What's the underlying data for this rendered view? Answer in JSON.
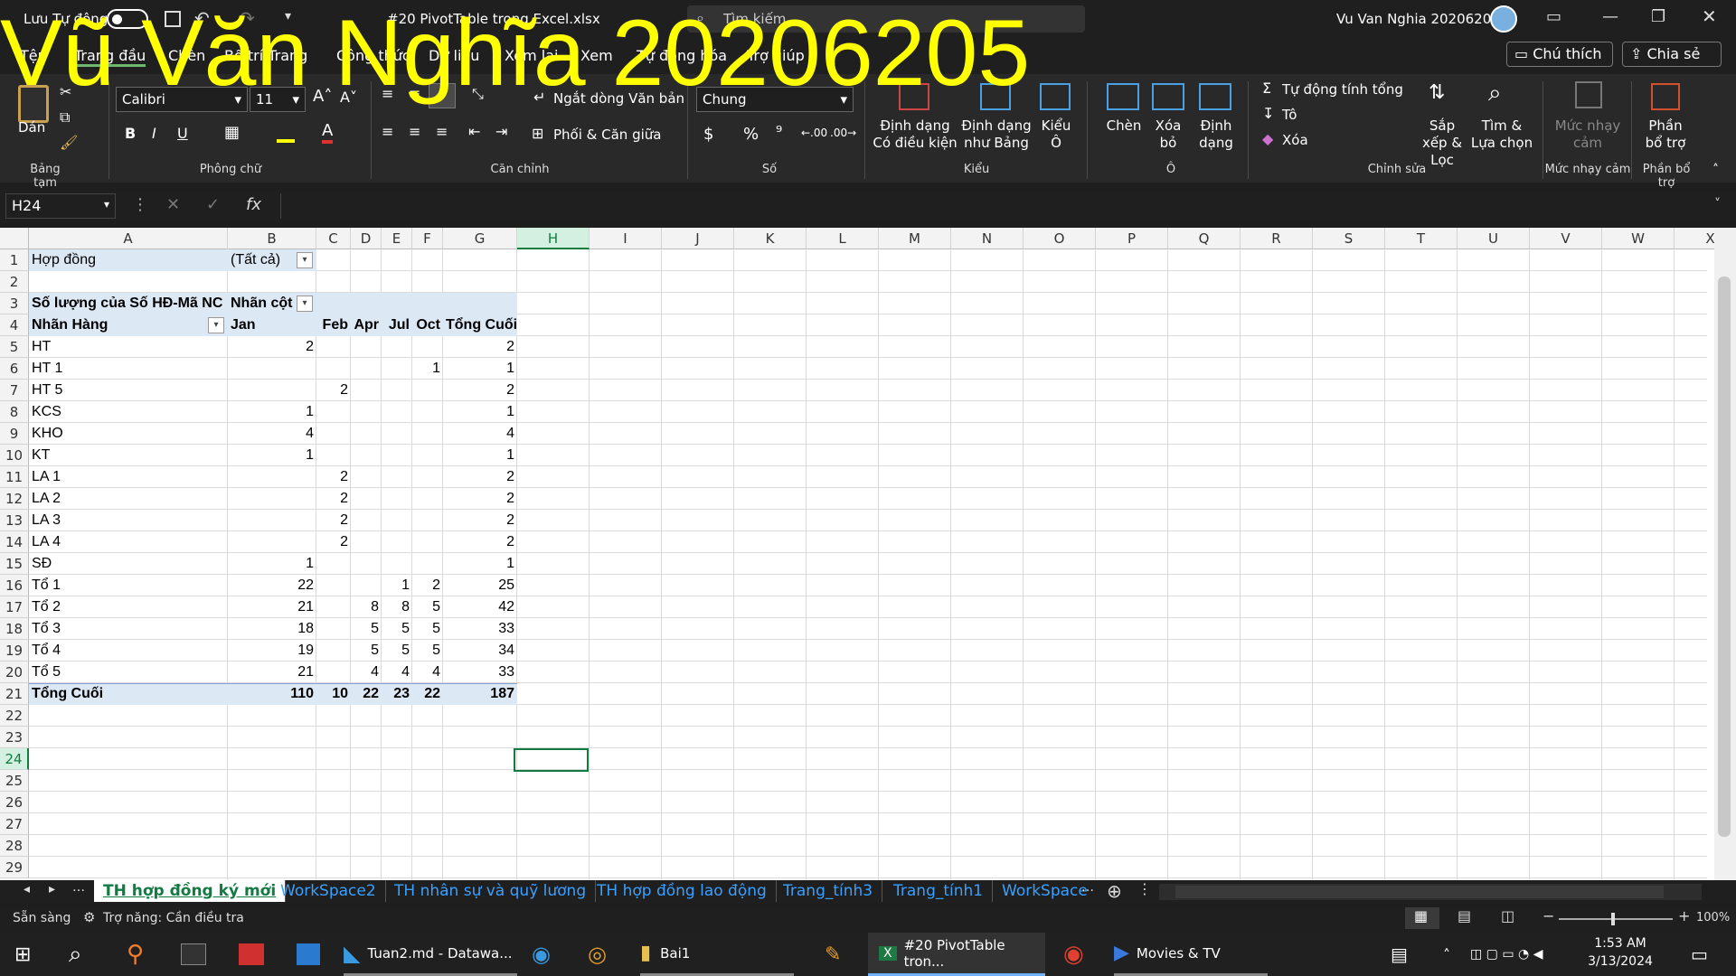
{
  "watermark": "Vũ Văn Nghĩa 20206205",
  "titlebar": {
    "autosave": "Lưu Tự động",
    "doc": "#20 PivotTable trong Excel.xlsx",
    "search": "Tìm kiếm",
    "user": "Vu Van Nghia 20206205"
  },
  "tabs": [
    "Tệp",
    "Trang đầu",
    "Chèn",
    "Bố trí Trang",
    "Công thức",
    "Dữ liệu",
    "Xem lại",
    "Xem",
    "Tự động hóa",
    "Trợ giúp"
  ],
  "comment_btn": "Chú thích",
  "share_btn": "Chia sẻ",
  "ribbon": {
    "paste": "Dán",
    "clipboard": "Bảng tạm",
    "font_name": "Calibri",
    "font_size": "11",
    "font_group": "Phông chữ",
    "wrap": "Ngắt dòng Văn bản",
    "merge": "Phối & Căn giữa",
    "align_group": "Căn chỉnh",
    "number_format": "Chung",
    "number_group": "Số",
    "cond_format": "Định dạng Có điều kiện",
    "format_table": "Định dạng như Bảng",
    "cell_styles": "Kiểu Ô",
    "styles_group": "Kiểu",
    "insert": "Chèn",
    "delete": "Xóa bỏ",
    "format": "Định dạng",
    "cells_group": "Ô",
    "autosum": "Tự động tính tổng",
    "fill": "Tô",
    "clear": "Xóa",
    "sort": "Sắp xếp & Lọc",
    "find": "Tìm & Lựa chọn",
    "editing_group": "Chỉnh sửa",
    "sensitivity": "Mức nhạy cảm",
    "addins": "Phần bổ trợ"
  },
  "namebox": "H24",
  "columns": [
    "A",
    "B",
    "C",
    "D",
    "E",
    "F",
    "G",
    "H",
    "I",
    "J",
    "K",
    "L",
    "M",
    "N",
    "O",
    "P",
    "Q",
    "R",
    "S",
    "T",
    "U",
    "V",
    "W",
    "X"
  ],
  "rows": [
    "1",
    "2",
    "3",
    "4",
    "5",
    "6",
    "7",
    "8",
    "9",
    "10",
    "11",
    "12",
    "13",
    "14",
    "15",
    "16",
    "17",
    "18",
    "19",
    "20",
    "21",
    "22",
    "23",
    "24",
    "25",
    "26",
    "27",
    "28",
    "29"
  ],
  "pivot": {
    "filter_label": "Hợp đồng",
    "filter_value": "(Tất cả)",
    "value_label": "Số lượng của Số HĐ-Mã NC",
    "col_label": "Nhãn cột",
    "row_label": "Nhãn Hàng",
    "headers": [
      "Jan",
      "Feb",
      "Apr",
      "Jul",
      "Oct",
      "Tổng Cuối"
    ],
    "data": [
      [
        "HT",
        "2",
        "",
        "",
        "",
        "",
        "2"
      ],
      [
        "HT 1",
        "",
        "",
        "",
        "",
        "1",
        "1"
      ],
      [
        "HT 5",
        "",
        "2",
        "",
        "",
        "",
        "2"
      ],
      [
        "KCS",
        "1",
        "",
        "",
        "",
        "",
        "1"
      ],
      [
        "KHO",
        "4",
        "",
        "",
        "",
        "",
        "4"
      ],
      [
        "KT",
        "1",
        "",
        "",
        "",
        "",
        "1"
      ],
      [
        "LA 1",
        "",
        "2",
        "",
        "",
        "",
        "2"
      ],
      [
        "LA 2",
        "",
        "2",
        "",
        "",
        "",
        "2"
      ],
      [
        "LA 3",
        "",
        "2",
        "",
        "",
        "",
        "2"
      ],
      [
        "LA 4",
        "",
        "2",
        "",
        "",
        "",
        "2"
      ],
      [
        "SĐ",
        "1",
        "",
        "",
        "",
        "",
        "1"
      ],
      [
        "Tổ 1",
        "22",
        "",
        "",
        "1",
        "2",
        "25"
      ],
      [
        "Tổ 2",
        "21",
        "",
        "8",
        "8",
        "5",
        "42"
      ],
      [
        "Tổ 3",
        "18",
        "",
        "5",
        "5",
        "5",
        "33"
      ],
      [
        "Tổ 4",
        "19",
        "",
        "5",
        "5",
        "5",
        "34"
      ],
      [
        "Tổ 5",
        "21",
        "",
        "4",
        "4",
        "4",
        "33"
      ]
    ],
    "total": [
      "Tổng Cuối",
      "110",
      "10",
      "22",
      "23",
      "22",
      "187"
    ]
  },
  "sheets": [
    "TH hợp đồng ký mới",
    "WorkSpace2",
    "TH nhân sự và quỹ lương",
    "TH hợp đồng lao động",
    "Trang_tính3",
    "Trang_tính1",
    "WorkSpace"
  ],
  "status": {
    "ready": "Sẵn sàng",
    "accessibility": "Trợ năng: Cần điều tra",
    "zoom": "100%"
  },
  "taskbar": {
    "vscode": "Tuan2.md - Datawa...",
    "folder": "Bai1",
    "excel": "#20 PivotTable tron...",
    "movies": "Movies & TV",
    "time": "1:53 AM",
    "date": "3/13/2024"
  }
}
